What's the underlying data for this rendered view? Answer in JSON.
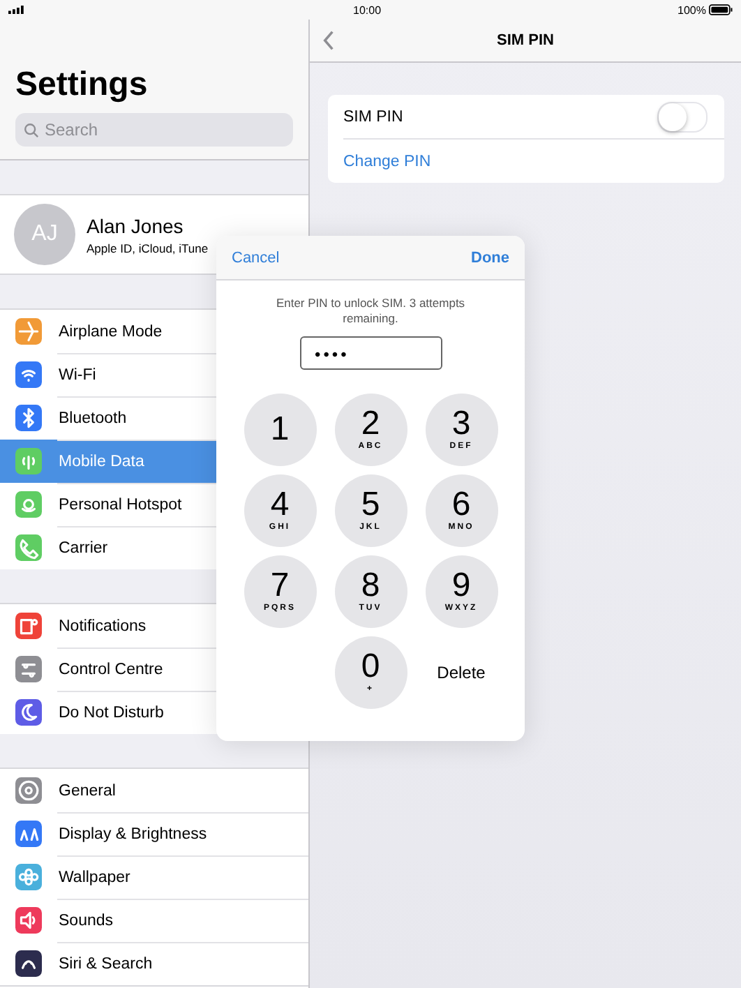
{
  "status_bar": {
    "time": "10:00",
    "battery": "100%"
  },
  "sidebar": {
    "title": "Settings",
    "search": {
      "placeholder": "Search"
    },
    "profile": {
      "initials": "AJ",
      "name": "Alan Jones",
      "subtitle": "Apple ID, iCloud, iTune"
    },
    "groups": [
      {
        "items": [
          {
            "label": "Airplane Mode",
            "color": "#f19a37",
            "selected": false
          },
          {
            "label": "Wi-Fi",
            "color": "#3478f6",
            "selected": false
          },
          {
            "label": "Bluetooth",
            "color": "#3478f6",
            "selected": false
          },
          {
            "label": "Mobile Data",
            "color": "#5fcd63",
            "selected": true
          },
          {
            "label": "Personal Hotspot",
            "color": "#5fcd63",
            "selected": false
          },
          {
            "label": "Carrier",
            "color": "#5fcd63",
            "selected": false
          }
        ]
      },
      {
        "items": [
          {
            "label": "Notifications",
            "color": "#ef4339",
            "selected": false
          },
          {
            "label": "Control Centre",
            "color": "#8e8e93",
            "selected": false
          },
          {
            "label": "Do Not Disturb",
            "color": "#5e5ce6",
            "selected": false
          }
        ]
      },
      {
        "items": [
          {
            "label": "General",
            "color": "#8e8e93",
            "selected": false
          },
          {
            "label": "Display & Brightness",
            "color": "#3478f6",
            "selected": false
          },
          {
            "label": "Wallpaper",
            "color": "#4ab0dc",
            "selected": false
          },
          {
            "label": "Sounds",
            "color": "#ee3a5b",
            "selected": false
          },
          {
            "label": "Siri & Search",
            "color": "#2c2c4e",
            "selected": false
          }
        ]
      }
    ]
  },
  "detail": {
    "title": "SIM PIN",
    "rows": [
      {
        "kind": "toggle",
        "label": "SIM PIN",
        "on": false
      },
      {
        "kind": "link",
        "label": "Change PIN"
      }
    ]
  },
  "dialog": {
    "cancel": "Cancel",
    "done": "Done",
    "message": "Enter PIN to unlock SIM. 3 attempts remaining.",
    "pin": "••••",
    "keys": [
      {
        "digit": "1"
      },
      {
        "digit": "2",
        "letters": "ABC"
      },
      {
        "digit": "3",
        "letters": "DEF"
      },
      {
        "digit": "4",
        "letters": "GHI"
      },
      {
        "digit": "5",
        "letters": "JKL"
      },
      {
        "digit": "6",
        "letters": "MNO"
      },
      {
        "digit": "7",
        "letters": "PQRS"
      },
      {
        "digit": "8",
        "letters": "TUV"
      },
      {
        "digit": "9",
        "letters": "WXYZ"
      },
      {
        "digit": "0",
        "letters": "+"
      }
    ],
    "delete": "Delete"
  }
}
